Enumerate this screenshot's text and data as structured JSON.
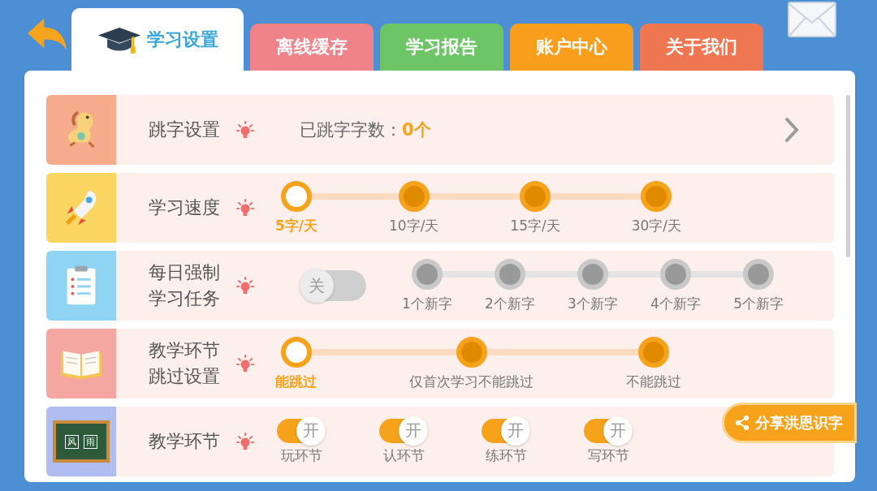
{
  "tabs": [
    {
      "label": "学习设置",
      "selected": true,
      "color": "#ffffff"
    },
    {
      "label": "离线缓存",
      "selected": false,
      "color": "#f0828a"
    },
    {
      "label": "学习报告",
      "selected": false,
      "color": "#6ec566"
    },
    {
      "label": "账户中心",
      "selected": false,
      "color": "#f99e1c"
    },
    {
      "label": "关于我们",
      "selected": false,
      "color": "#ee7752"
    }
  ],
  "rows": [
    {
      "kind": "link",
      "title": "跳字设置",
      "label": "已跳字字数：",
      "value": "0个"
    },
    {
      "kind": "steps",
      "title": "学习速度",
      "steps": [
        {
          "label": "5字/天",
          "selected": true
        },
        {
          "label": "10字/天",
          "selected": false
        },
        {
          "label": "15字/天",
          "selected": false
        },
        {
          "label": "30字/天",
          "selected": false
        }
      ]
    },
    {
      "kind": "toggle_steps",
      "title": "每日强制学习任务",
      "toggle": {
        "on": false,
        "text": "关"
      },
      "steps": [
        {
          "label": "1个新字",
          "selected": false
        },
        {
          "label": "2个新字",
          "selected": false
        },
        {
          "label": "3个新字",
          "selected": false
        },
        {
          "label": "4个新字",
          "selected": false
        },
        {
          "label": "5个新字",
          "selected": false
        }
      ]
    },
    {
      "kind": "steps",
      "title": "教学环节跳过设置",
      "steps": [
        {
          "label": "能跳过",
          "selected": true
        },
        {
          "label": "仅首次学习不能跳过",
          "selected": false
        },
        {
          "label": "不能跳过",
          "selected": false
        }
      ]
    },
    {
      "kind": "toggles",
      "title": "教学环节",
      "board_text": [
        "风",
        "雨"
      ],
      "toggles": [
        {
          "label": "玩环节",
          "on": true,
          "text": "开"
        },
        {
          "label": "认环节",
          "on": true,
          "text": "开"
        },
        {
          "label": "练环节",
          "on": true,
          "text": "开"
        },
        {
          "label": "写环节",
          "on": true,
          "text": "开"
        }
      ]
    }
  ],
  "share_button": "分享洪恩识字"
}
